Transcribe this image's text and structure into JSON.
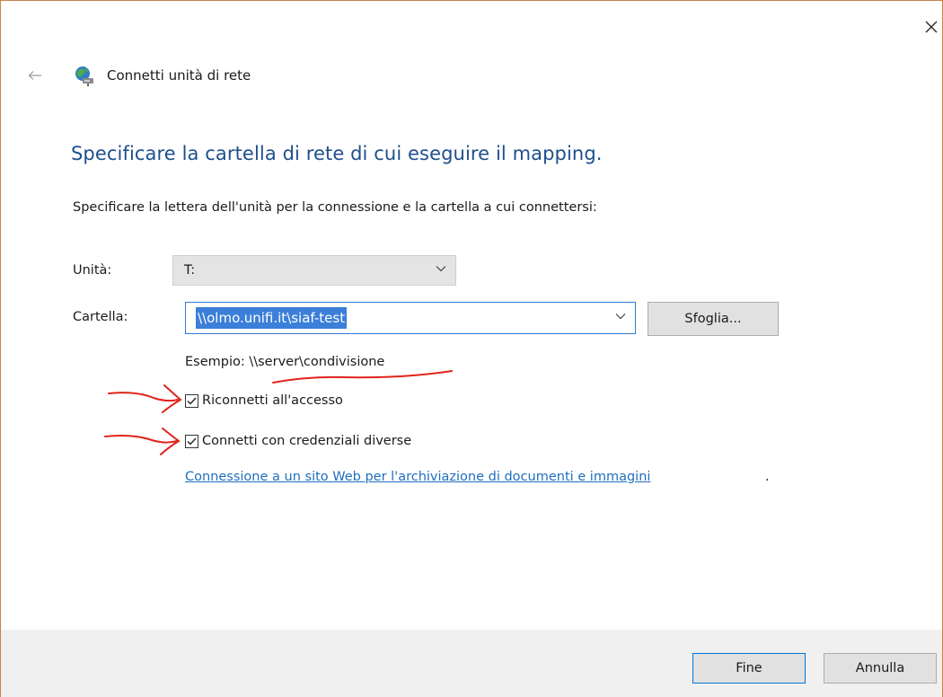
{
  "window": {
    "title": "Connetti unità di rete",
    "close_icon": "close-icon",
    "back_icon": "back-arrow-icon",
    "app_icon": "network-drive-icon"
  },
  "page": {
    "heading": "Specificare la cartella di rete di cui eseguire il mapping.",
    "description": "Specificare la lettera dell'unità per la connessione e la cartella a cui connettersi:"
  },
  "form": {
    "drive_label": "Unità:",
    "drive_value": "T:",
    "folder_label": "Cartella:",
    "folder_value": "\\\\olmo.unifi.it\\siaf-test",
    "browse_label": "Sfoglia...",
    "example": "Esempio: \\\\server\\condivisione"
  },
  "options": {
    "reconnect_label": "Riconnetti all'accesso",
    "reconnect_checked": true,
    "credentials_label": "Connetti con credenziali diverse",
    "credentials_checked": true
  },
  "link": {
    "text": "Connessione a un sito Web per l'archiviazione di documenti e immagini",
    "suffix": "."
  },
  "footer": {
    "finish_label": "Fine",
    "cancel_label": "Annulla"
  },
  "colors": {
    "heading": "#1e4f8c",
    "link": "#1f6fbf",
    "selection": "#3b7fd8",
    "annotation": "#e0231b"
  }
}
